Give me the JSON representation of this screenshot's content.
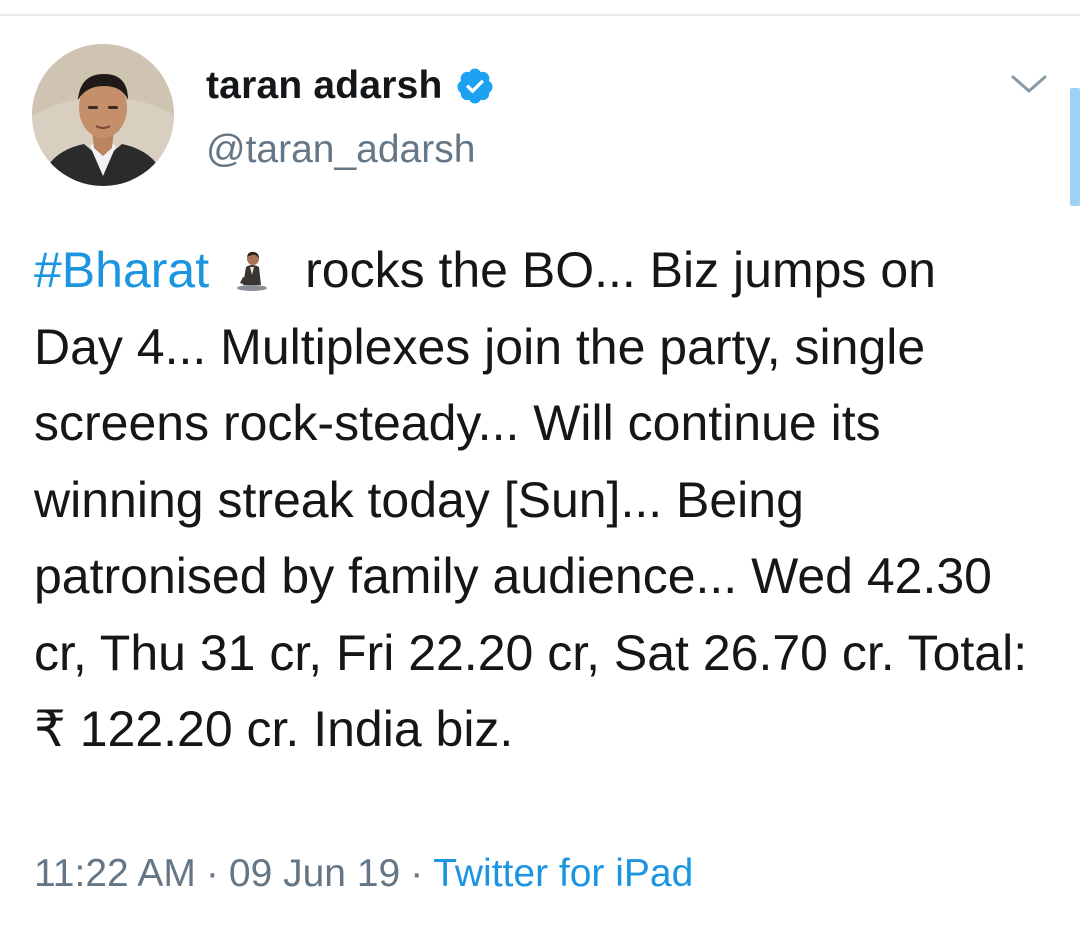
{
  "user": {
    "display_name": "taran adarsh",
    "handle": "@taran_adarsh",
    "verified": true,
    "verified_icon": "verified-badge-icon",
    "verified_color": "#1da1f2"
  },
  "menu": {
    "icon": "chevron-down-icon"
  },
  "tweet": {
    "hashtag": "#Bharat",
    "emoji": "man-in-suit-levitating-emoji",
    "body_line1": "rocks the BO... Biz jumps",
    "body_rest": "on Day 4... Multiplexes join the party, single screens rock-steady... Will continue its winning streak today [Sun]... Being patronised by family audience... Wed 42.30 cr, Thu 31 cr, Fri 22.20 cr, Sat 26.70 cr. Total: ₹ 122.20 cr. India biz."
  },
  "meta": {
    "time": "11:22 AM",
    "separator": "·",
    "date": "09 Jun 19",
    "source": "Twitter for iPad"
  },
  "colors": {
    "link": "#1b95e0",
    "secondary_text": "#657786",
    "primary_text": "#14171a"
  }
}
